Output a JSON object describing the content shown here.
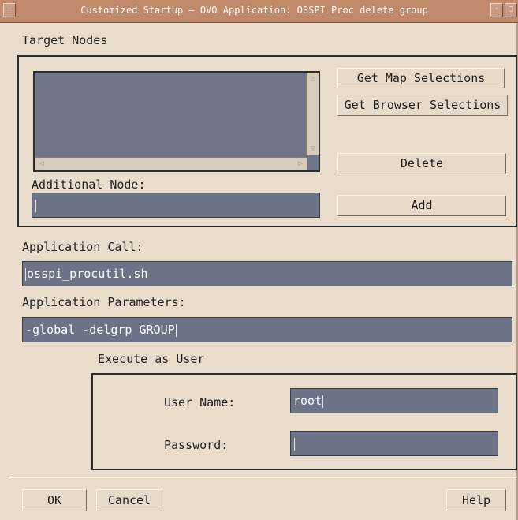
{
  "window": {
    "title": "Customized Startup — OVO Application: OSSPI Proc delete group"
  },
  "target_nodes": {
    "label": "Target Nodes",
    "list_items": [],
    "get_map_selections": "Get Map Selections",
    "get_browser_selections": "Get Browser Selections",
    "delete_label": "Delete",
    "add_label": "Add",
    "additional_node_label": "Additional Node:",
    "additional_node_value": ""
  },
  "application_call": {
    "label": "Application Call:",
    "value": "osspi_procutil.sh"
  },
  "application_parameters": {
    "label": "Application Parameters:",
    "value": "-global -delgrp GROUP"
  },
  "execute_as_user": {
    "label": "Execute as User",
    "user_name_label": "User Name:",
    "user_name_value": "root",
    "password_label": "Password:",
    "password_value": ""
  },
  "footer": {
    "ok": "OK",
    "cancel": "Cancel",
    "help": "Help"
  },
  "colors": {
    "titlebar": "#c08a6a",
    "background": "#e9dccd",
    "field": "#6d7386"
  }
}
